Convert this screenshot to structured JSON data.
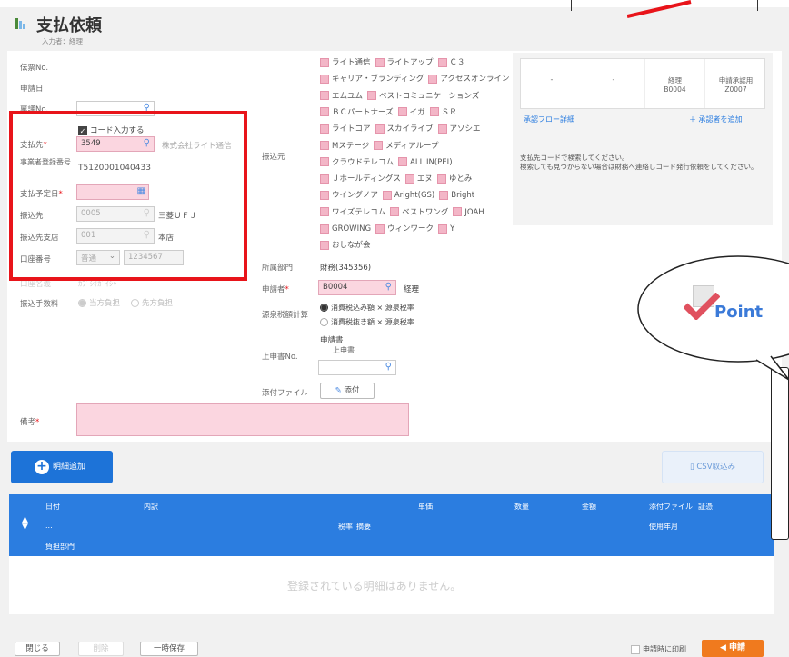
{
  "header": {
    "title": "支払依頼",
    "subtitle": "入力者：経理"
  },
  "left": {
    "labels": {
      "voucher_no": "伝票No.",
      "apply_date": "申請日",
      "ringi_no": "稟議No.",
      "payee": "支払先",
      "reg_no": "事業者登録番号",
      "pay_date": "支払予定日",
      "bank": "振込先",
      "branch": "振込先支店",
      "account": "口座番号",
      "account_name": "口座名義",
      "fee": "振込手数料",
      "note": "備考"
    },
    "code_input_label": "コード入力する",
    "payee_code": "3549",
    "payee_name": "株式会社ライト通信",
    "reg_number": "T5120001040433",
    "bank_code": "0005",
    "bank_name": "三菱ＵＦＪ",
    "branch_code": "001",
    "branch_name": "本店",
    "account_type": "普通",
    "account_no": "1234567",
    "account_holder": "ｶﾌﾞｼｷｶﾞｲｼｬ",
    "fee_options": [
      "当方負担",
      "先方負担"
    ]
  },
  "mid": {
    "labels": {
      "transfer_from": "振込元",
      "dept": "所属部門",
      "applicant": "申請者",
      "tax_calc": "源泉税額計算",
      "superior_no": "上申書No.",
      "attachment": "添付ファイル"
    },
    "companies": [
      [
        "ライト通信",
        "ライトアップ",
        "Ｃ３"
      ],
      [
        "キャリア・ブランディング",
        "アクセスオンライン"
      ],
      [
        "エムユム",
        "ベストコミュニケーションズ"
      ],
      [
        "ＢＣパートナーズ",
        "イガ",
        "ＳＲ"
      ],
      [
        "ライトコア",
        "スカイライブ",
        "アソシエ"
      ],
      [
        "Mステージ",
        "メディアループ"
      ],
      [
        "クラウドテレコム",
        "ALL IN(PEI)"
      ],
      [
        "Ｊホールディングス",
        "エヌ",
        "ゆとみ"
      ],
      [
        "ウイングノア",
        "Aright(GS)",
        "Bright"
      ],
      [
        "ワイズテレコム",
        "ベストワング",
        "JOAH"
      ],
      [
        "GROWING",
        "ウィンワーク",
        "Y"
      ],
      [
        "おしなが会"
      ]
    ],
    "dept_value": "財務(345356)",
    "applicant_code": "B0004",
    "applicant_name": "経理",
    "tax_options": [
      "消費税込み額 × 源泉税率",
      "消費税抜き額 × 源泉税率"
    ],
    "superior_title": "申請書",
    "superior_sub": "上申書",
    "attach_button": "添付"
  },
  "approval": {
    "cols": [
      {
        "top": "-",
        "bottom": ""
      },
      {
        "top": "-",
        "bottom": ""
      },
      {
        "top": "経理",
        "bottom": "B0004"
      },
      {
        "top": "申請承認用",
        "bottom": "Z0007"
      }
    ],
    "flow_link": "承認フロー詳細",
    "add_link": "＋ 承認者を追加"
  },
  "hint": {
    "line1": "支払先コードで検索してください。",
    "line2": "検索しても見つからない場合は財務へ連絡しコード発行依頼をしてください。"
  },
  "callout": {
    "label": "Point"
  },
  "toolbar": {
    "add_detail": "明細追加",
    "csv_import": "CSV取込み"
  },
  "table": {
    "row1": [
      "日付",
      "内訳",
      "単価",
      "数量",
      "金額",
      "添付ファイル",
      "証憑"
    ],
    "row2": [
      "...",
      "税率",
      "摘要",
      "使用年月"
    ],
    "row3": [
      "負担部門"
    ],
    "empty": "登録されている明細はありません。"
  },
  "footer": {
    "close": "閉じる",
    "delete": "削除",
    "save_temp": "一時保存",
    "print_label": "申請時に印刷",
    "submit": "申請"
  },
  "colors": {
    "accent": "#1d73d8",
    "pink_field": "#fbd6e0",
    "highlight_border": "#e8141a",
    "submit": "#f07a1e",
    "table_header": "#2b7de0"
  }
}
